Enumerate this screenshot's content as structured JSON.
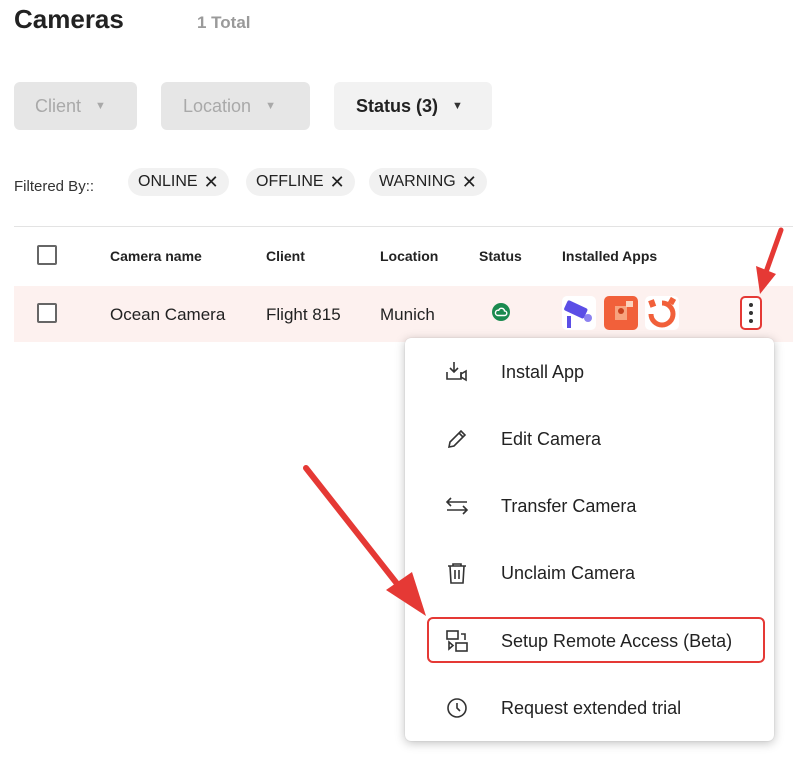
{
  "header": {
    "title": "Cameras",
    "total": "1 Total"
  },
  "filters": {
    "client_label": "Client",
    "location_label": "Location",
    "status_label": "Status (3)",
    "filtered_by_label": "Filtered By::",
    "chips": [
      "ONLINE",
      "OFFLINE",
      "WARNING"
    ]
  },
  "table": {
    "columns": [
      "Camera name",
      "Client",
      "Location",
      "Status",
      "Installed Apps"
    ],
    "rows": [
      {
        "camera_name": "Ocean Camera",
        "client": "Flight 815",
        "location": "Munich",
        "status": "online"
      }
    ]
  },
  "context_menu": {
    "items": [
      {
        "label": "Install App",
        "icon": "install-app-icon"
      },
      {
        "label": "Edit Camera",
        "icon": "pencil-icon"
      },
      {
        "label": "Transfer Camera",
        "icon": "transfer-arrows-icon"
      },
      {
        "label": "Unclaim Camera",
        "icon": "trash-icon"
      },
      {
        "label": "Setup Remote Access (Beta)",
        "icon": "remote-access-icon"
      },
      {
        "label": "Request extended trial",
        "icon": "clock-icon"
      }
    ]
  },
  "colors": {
    "accent_red": "#e53935",
    "status_online": "#1a8a4f",
    "row_highlight": "#fdf1ef",
    "app_purple": "#5b4ee6",
    "app_orange": "#f1603a"
  }
}
